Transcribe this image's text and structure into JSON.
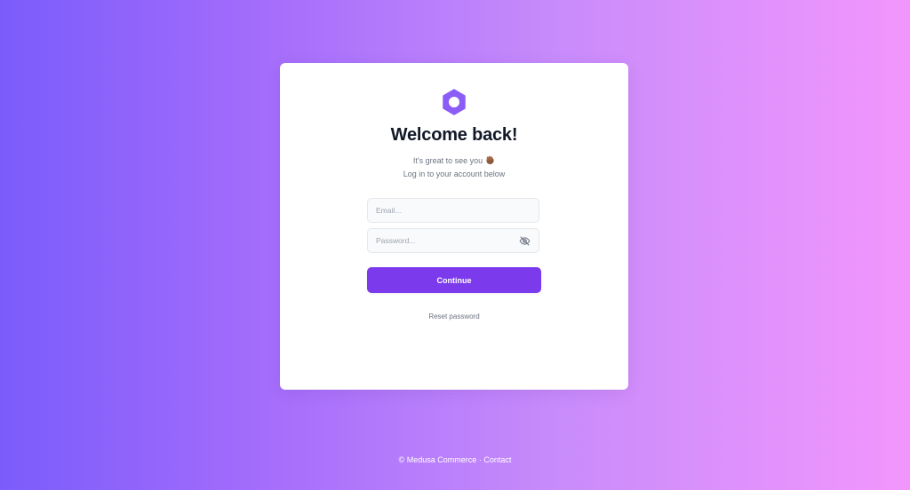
{
  "login": {
    "logo_icon": "medusa-logo-icon",
    "title": "Welcome back!",
    "subtitle_line1": "It's great to see you",
    "subtitle_emoji": "waving-hand-emoji",
    "subtitle_line2": "Log in to your account below",
    "email": {
      "value": "",
      "placeholder": "Email..."
    },
    "password": {
      "value": "",
      "placeholder": "Password...",
      "visibility_icon": "eye-off-icon"
    },
    "continue_label": "Continue",
    "reset_label": "Reset password"
  },
  "footer": {
    "copyright": "© Medusa Commerce",
    "separator": "·",
    "contact_label": "Contact"
  },
  "colors": {
    "accent": "#7c3aed",
    "logo": "#8b5cf6",
    "background_start": "#7b5cfb",
    "background_end": "#f296fc"
  }
}
